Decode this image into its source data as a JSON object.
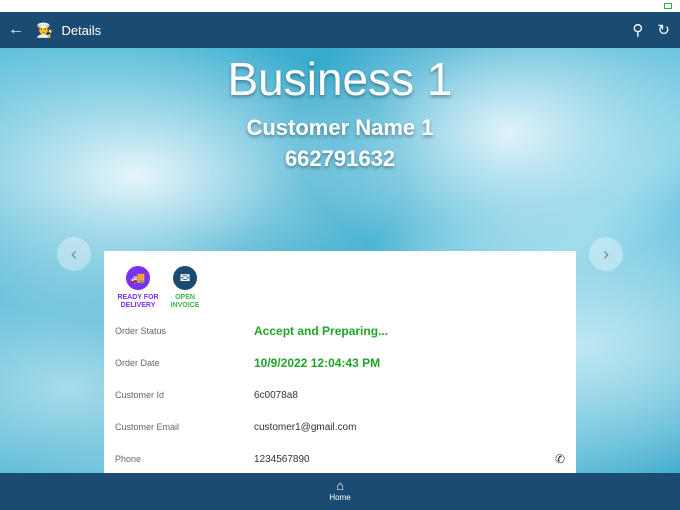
{
  "appbar": {
    "title": "Details"
  },
  "hero": {
    "business": "Business 1",
    "customer": "Customer Name 1",
    "phone": "662791632"
  },
  "actions": [
    {
      "label": "READY FOR DELIVERY",
      "color": "#7b2ff7"
    },
    {
      "label": "OPEN INVOICE",
      "color": "#1b4b73",
      "label_color": "#3bb54a"
    }
  ],
  "fields": [
    {
      "label": "Order Status",
      "value": "Accept and Preparing..."
    },
    {
      "label": "Order Date",
      "value": "10/9/2022 12:04:43 PM"
    },
    {
      "label": "Customer Id",
      "value": "6c0078a8"
    },
    {
      "label": "Customer Email",
      "value": "customer1@gmail.com"
    },
    {
      "label": "Phone",
      "value": "1234567890"
    }
  ],
  "bottom": {
    "home_label": "Home"
  }
}
